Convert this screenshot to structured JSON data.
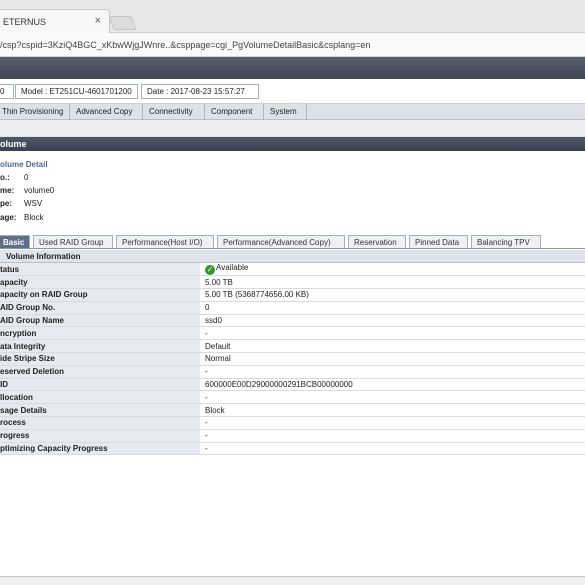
{
  "browser": {
    "tab_title": "ETERNUS",
    "tab_close": "×",
    "url": "/csp?cspid=3KziQ4BGC_xKbwWjgJWnre..&csppage=cgi_PgVolumeDetailBasic&csplang=en"
  },
  "info": {
    "status": "0",
    "model": "Model : ET251CU-4601701200",
    "date": "Date : 2017-08-23 15:57:27"
  },
  "menu": [
    "Thin Provisioning",
    "Advanced Copy",
    "Connectivity",
    "Component",
    "System"
  ],
  "section_title": "olume",
  "detail": {
    "title": "olume Detail",
    "fields": [
      {
        "k": "o.:",
        "v": "0"
      },
      {
        "k": "me:",
        "v": "volume0"
      },
      {
        "k": "pe:",
        "v": "WSV"
      },
      {
        "k": "age:",
        "v": "Block"
      }
    ]
  },
  "subtabs": [
    "Basic",
    "Used RAID Group",
    "Performance(Host I/O)",
    "Performance(Advanced Copy)",
    "Reservation",
    "Pinned Data",
    "Balancing TPV"
  ],
  "panel_title": "Volume Information",
  "rows": [
    {
      "k": "tatus",
      "v": "Available"
    },
    {
      "k": "apacity",
      "v": "5.00 TB"
    },
    {
      "k": "apacity on RAID Group",
      "v": "5.00 TB (5368774656.00 KB)"
    },
    {
      "k": "AID Group No.",
      "v": "0"
    },
    {
      "k": "AID Group Name",
      "v": "ssd0"
    },
    {
      "k": "ncryption",
      "v": "-"
    },
    {
      "k": "ata Integrity",
      "v": "Default"
    },
    {
      "k": "ide Stripe Size",
      "v": "Normal"
    },
    {
      "k": "eserved Deletion",
      "v": "-"
    },
    {
      "k": "ID",
      "v": "600000E00D29000000291BCB00000000"
    },
    {
      "k": "llocation",
      "v": "-"
    },
    {
      "k": "sage Details",
      "v": "Block"
    },
    {
      "k": "rocess",
      "v": "-"
    },
    {
      "k": "rogress",
      "v": "-"
    },
    {
      "k": "ptimizing Capacity Progress",
      "v": "-"
    }
  ]
}
